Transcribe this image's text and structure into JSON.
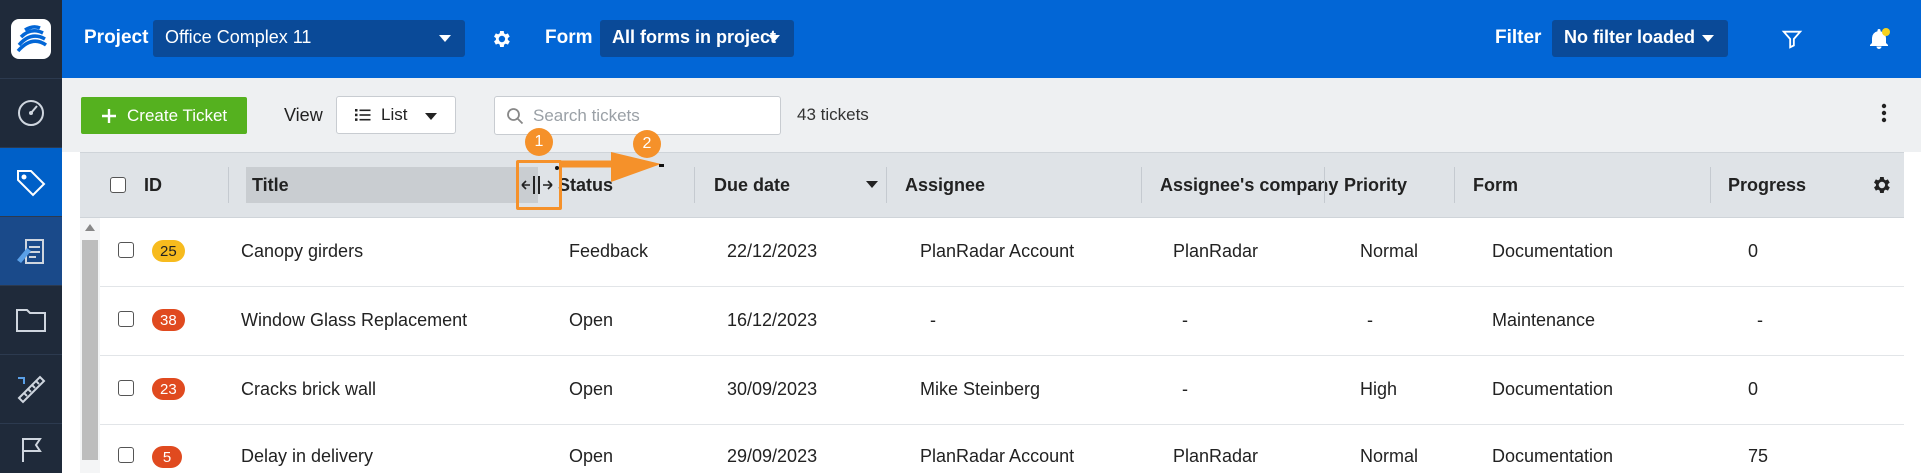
{
  "topbar": {
    "project_label": "Project",
    "project_value": "Office Complex 11",
    "form_label": "Form",
    "form_value": "All forms in project",
    "filter_label": "Filter",
    "filter_value": "No filter loaded"
  },
  "toolbar": {
    "create_label": "Create Ticket",
    "view_label": "View",
    "view_value": "List",
    "search_placeholder": "Search tickets",
    "count": "43 tickets"
  },
  "columns": [
    "ID",
    "Title",
    "Status",
    "Due date",
    "Assignee",
    "Assignee's company",
    "Priority",
    "Form",
    "Progress"
  ],
  "rows": [
    {
      "id": "25",
      "badge_color": "#f7bb1e",
      "badge_text": "#222222",
      "title": "Canopy girders",
      "status": "Feedback",
      "due": "22/12/2023",
      "assignee": "PlanRadar Account",
      "company": "PlanRadar",
      "priority": "Normal",
      "form": "Documentation",
      "progress": "0"
    },
    {
      "id": "38",
      "badge_color": "#e04a1f",
      "badge_text": "#ffffff",
      "title": "Window Glass Replacement",
      "status": "Open",
      "due": "16/12/2023",
      "assignee": "-",
      "company": "-",
      "priority": "-",
      "form": "Maintenance",
      "progress": "-"
    },
    {
      "id": "23",
      "badge_color": "#e04a1f",
      "badge_text": "#ffffff",
      "title": "Cracks brick wall",
      "status": "Open",
      "due": "30/09/2023",
      "assignee": "Mike Steinberg",
      "company": "-",
      "priority": "High",
      "form": "Documentation",
      "progress": "0"
    },
    {
      "id": "5",
      "badge_color": "#e04a1f",
      "badge_text": "#ffffff",
      "title": "Delay in delivery",
      "status": "Open",
      "due": "29/09/2023",
      "assignee": "PlanRadar Account",
      "company": "PlanRadar",
      "priority": "Normal",
      "form": "Documentation",
      "progress": "75"
    }
  ],
  "annotations": {
    "step1": "1",
    "step2": "2"
  },
  "colors": {
    "brand_blue": "#0266d6",
    "create_green": "#55b11f",
    "annotation_orange": "#f5912a"
  },
  "icons": {
    "sidebar": [
      "logo-icon",
      "dashboard-icon",
      "tickets-icon",
      "forms-icon",
      "folder-icon",
      "ruler-icon",
      "flag-icon"
    ],
    "topbar": [
      "gear-icon",
      "filter-funnel-icon",
      "bell-icon"
    ]
  }
}
